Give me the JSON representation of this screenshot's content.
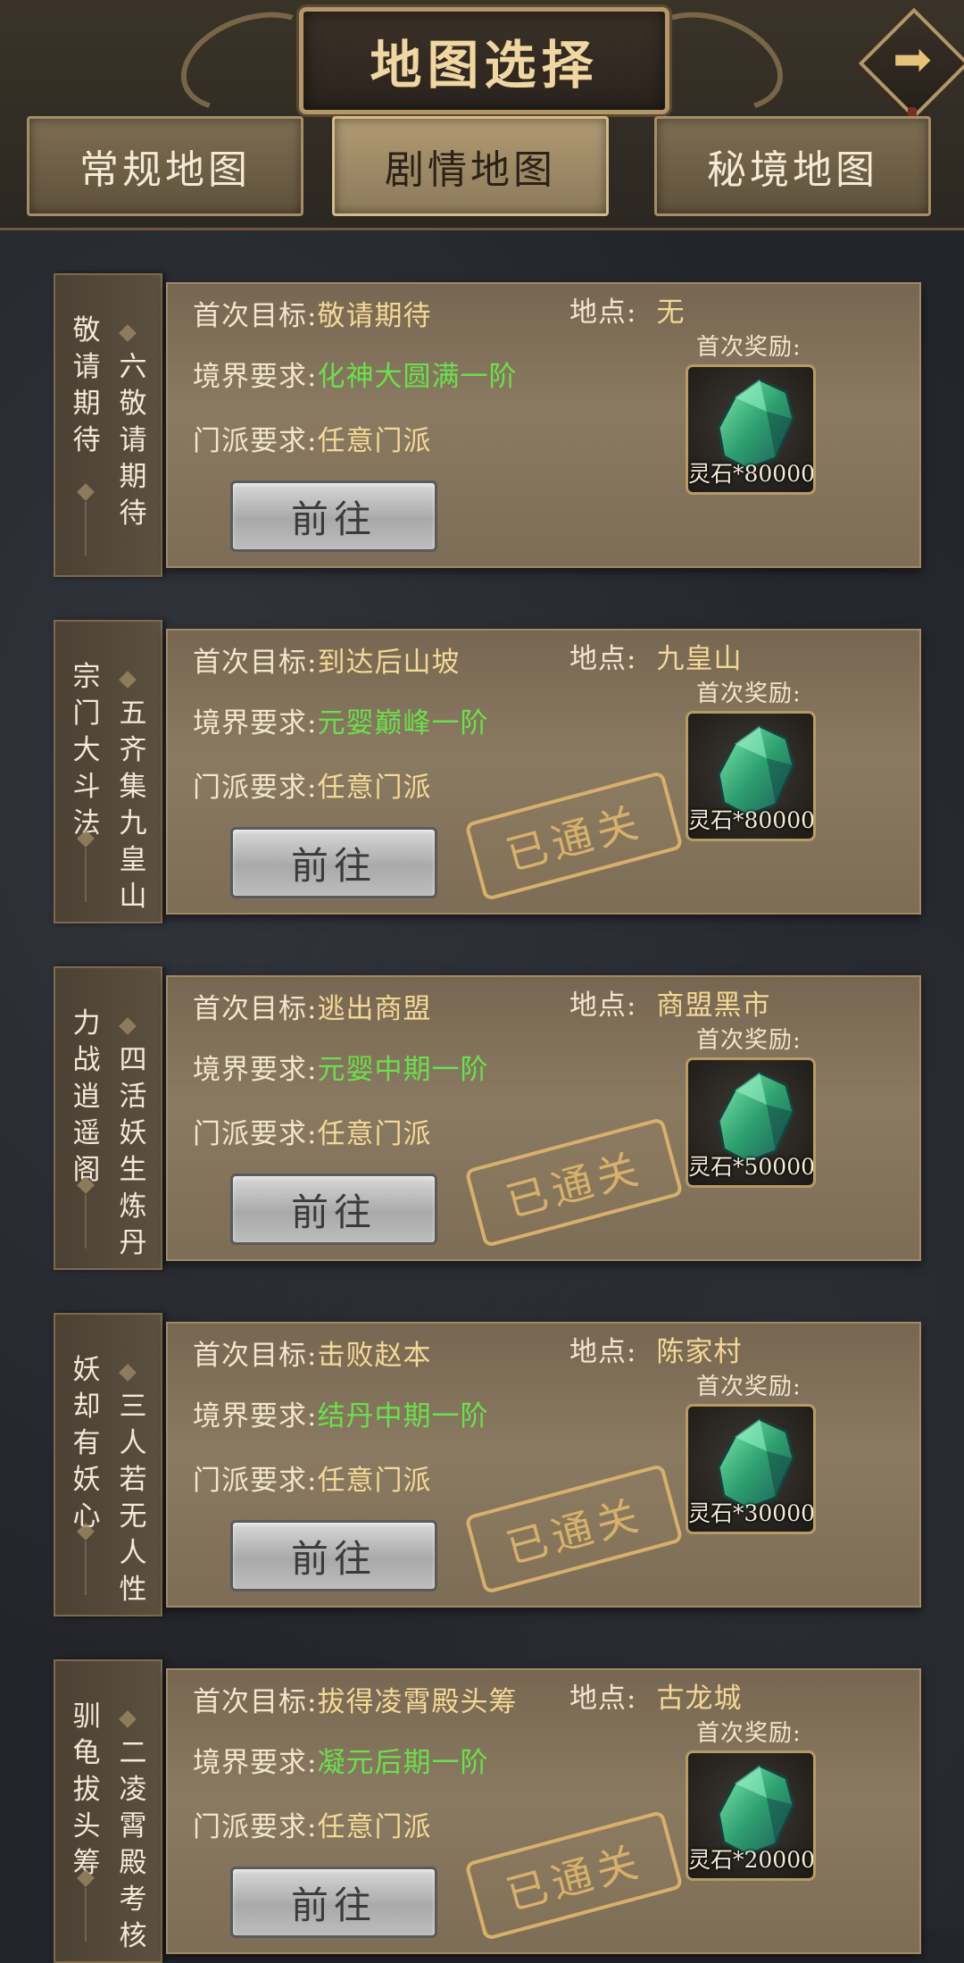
{
  "header": {
    "title": "地图选择",
    "next_icon": "arrow-right-icon"
  },
  "tabs": [
    {
      "label": "常规地图",
      "active": false
    },
    {
      "label": "剧情地图",
      "active": true
    },
    {
      "label": "秘境地图",
      "active": false
    }
  ],
  "labels": {
    "goal": "首次目标:",
    "realm": "境界要求:",
    "sect": "门派要求:",
    "location": "地点:",
    "reward": "首次奖励:",
    "go": "前往",
    "cleared": "已通关"
  },
  "colors": {
    "gold_value": "#f4d896",
    "green_value": "#6ae14a",
    "stamp": "#d7b16b"
  },
  "cards": [
    {
      "side_left": "敬请期待",
      "side_right": "六敬请期待",
      "goal": "敬请期待",
      "location": "无",
      "realm": "化神大圆满一阶",
      "sect": "任意门派",
      "reward": "灵石*80000",
      "cleared": false
    },
    {
      "side_left": "宗门大斗法",
      "side_right": "五齐集九皇山",
      "goal": "到达后山坡",
      "location": "九皇山",
      "realm": "元婴巅峰一阶",
      "sect": "任意门派",
      "reward": "灵石*80000",
      "cleared": true
    },
    {
      "side_left": "力战逍遥阁",
      "side_right": "四活妖生炼丹",
      "goal": "逃出商盟",
      "location": "商盟黑市",
      "realm": "元婴中期一阶",
      "sect": "任意门派",
      "reward": "灵石*50000",
      "cleared": true
    },
    {
      "side_left": "妖却有妖心",
      "side_right": "三人若无人性",
      "goal": "击败赵本",
      "location": "陈家村",
      "realm": "结丹中期一阶",
      "sect": "任意门派",
      "reward": "灵石*30000",
      "cleared": true
    },
    {
      "side_left": "驯龟拔头筹",
      "side_right": "二凌霄殿考核",
      "goal": "拔得凌霄殿头筹",
      "location": "古龙城",
      "realm": "凝元后期一阶",
      "sect": "任意门派",
      "reward": "灵石*20000",
      "cleared": true
    }
  ]
}
